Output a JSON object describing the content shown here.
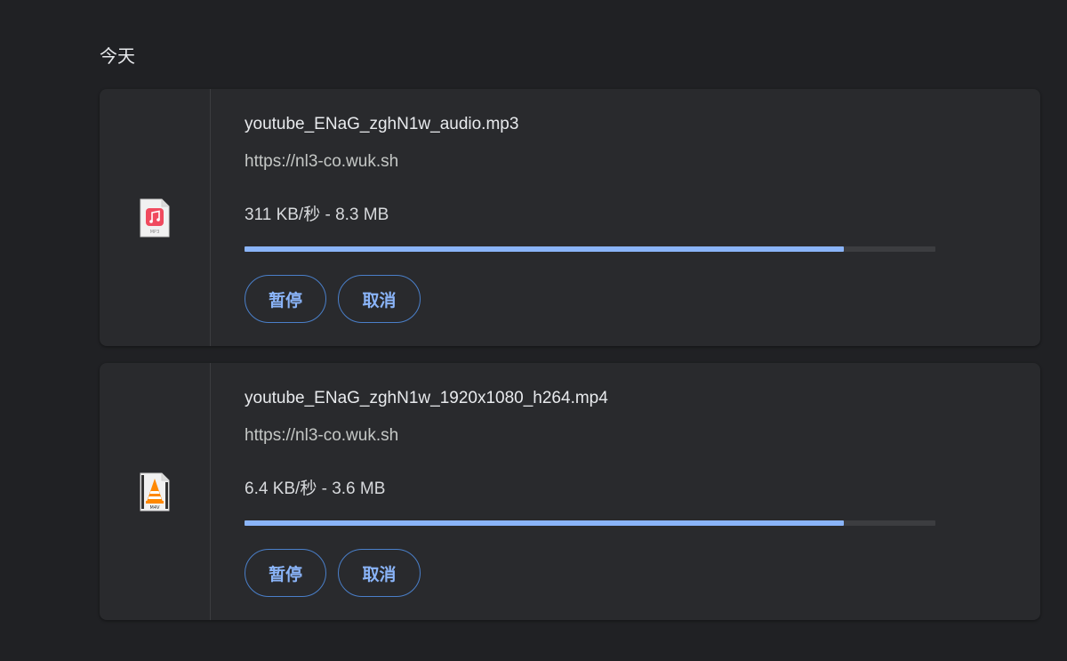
{
  "section": {
    "title": "今天"
  },
  "downloads": [
    {
      "file_name": "youtube_ENaG_zghN1w_audio.mp3",
      "url": "https://nl3-co.wuk.sh",
      "status": "311 KB/秒 - 8.3 MB",
      "progress_fraction": 0.867,
      "icon": "mp3-music-file-icon",
      "icon_label": "MP3",
      "pause_label": "暂停",
      "cancel_label": "取消"
    },
    {
      "file_name": "youtube_ENaG_zghN1w_1920x1080_h264.mp4",
      "url": "https://nl3-co.wuk.sh",
      "status": "6.4 KB/秒 - 3.6 MB",
      "progress_fraction": 0.867,
      "icon": "m4v-vlc-video-file-icon",
      "icon_label": "M4V",
      "pause_label": "暂停",
      "cancel_label": "取消"
    }
  ],
  "colors": {
    "background": "#202124",
    "card": "#292a2d",
    "accent": "#8ab4f8",
    "button_border": "#4a7fc9",
    "track": "#3c3d40"
  }
}
